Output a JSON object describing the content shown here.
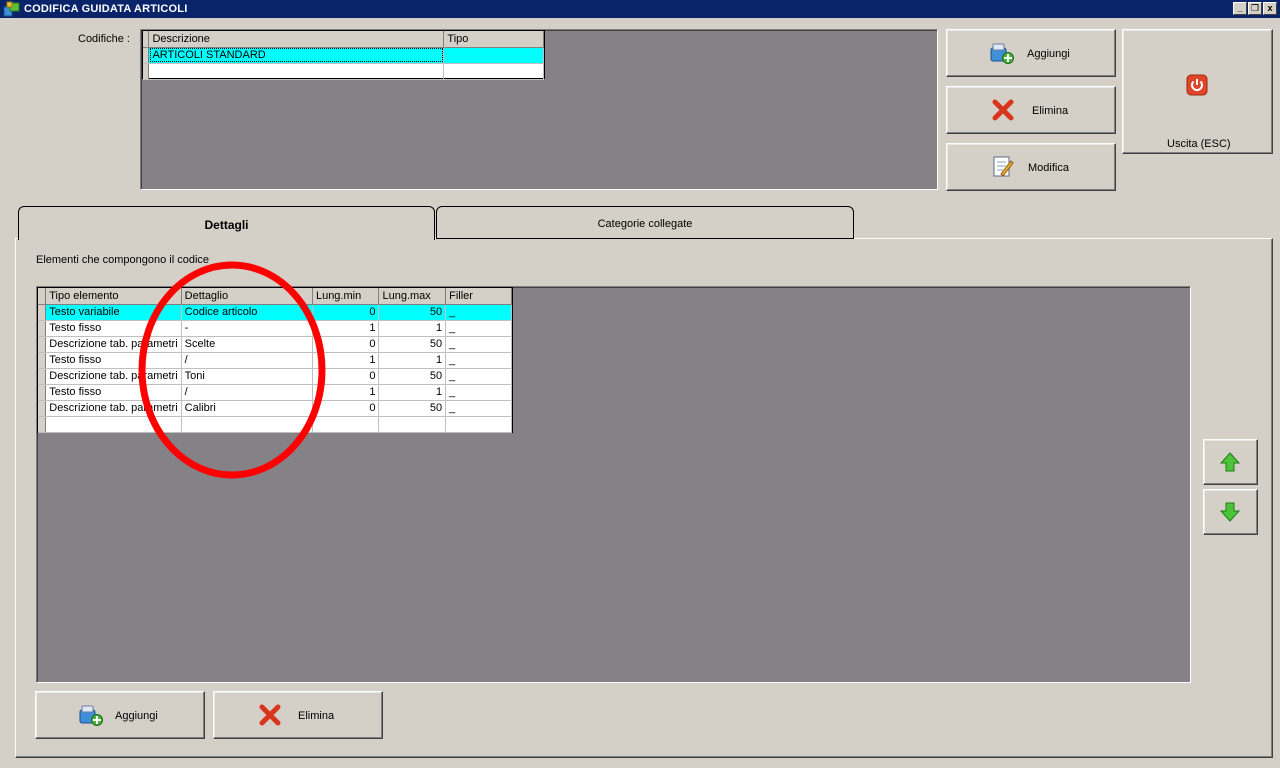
{
  "window": {
    "title": "CODIFICA GUIDATA ARTICOLI",
    "minimize_glyph": "_",
    "restore_glyph": "❐",
    "close_glyph": "x"
  },
  "codifiche": {
    "label": "Codifiche :",
    "columns": [
      "Descrizione",
      "Tipo"
    ],
    "rows": [
      {
        "descrizione": "ARTICOLI STANDARD",
        "tipo": ""
      }
    ]
  },
  "top_buttons": {
    "add": "Aggiungi",
    "delete": "Elimina",
    "edit": "Modifica",
    "exit": "Uscita (ESC)"
  },
  "tabs": [
    {
      "label": "Dettagli",
      "active": true
    },
    {
      "label": "Categorie collegate",
      "active": false
    }
  ],
  "details": {
    "section_label": "Elementi che compongono il codice",
    "columns": [
      "Tipo elemento",
      "Dettaglio",
      "Lung.min",
      "Lung.max",
      "Filler"
    ],
    "rows": [
      {
        "tipo": "Testo variabile",
        "dettaglio": "Codice articolo",
        "min": "0",
        "max": "50",
        "filler": "_"
      },
      {
        "tipo": "Testo fisso",
        "dettaglio": "-",
        "min": "1",
        "max": "1",
        "filler": "_"
      },
      {
        "tipo": "Descrizione tab. parametri",
        "dettaglio": "Scelte",
        "min": "0",
        "max": "50",
        "filler": "_"
      },
      {
        "tipo": "Testo fisso",
        "dettaglio": "/",
        "min": "1",
        "max": "1",
        "filler": "_"
      },
      {
        "tipo": "Descrizione tab. parametri",
        "dettaglio": "Toni",
        "min": "0",
        "max": "50",
        "filler": "_"
      },
      {
        "tipo": "Testo fisso",
        "dettaglio": "/",
        "min": "1",
        "max": "1",
        "filler": "_"
      },
      {
        "tipo": "Descrizione tab. parametri",
        "dettaglio": "Calibri",
        "min": "0",
        "max": "50",
        "filler": "_"
      }
    ]
  },
  "bottom_buttons": {
    "add": "Aggiungi",
    "delete": "Elimina"
  },
  "colors": {
    "titlebar": "#0a246a",
    "selection": "#00ffff",
    "panel": "#858287",
    "annotation": "#ff0000",
    "exit_icon": "#e0452a"
  }
}
